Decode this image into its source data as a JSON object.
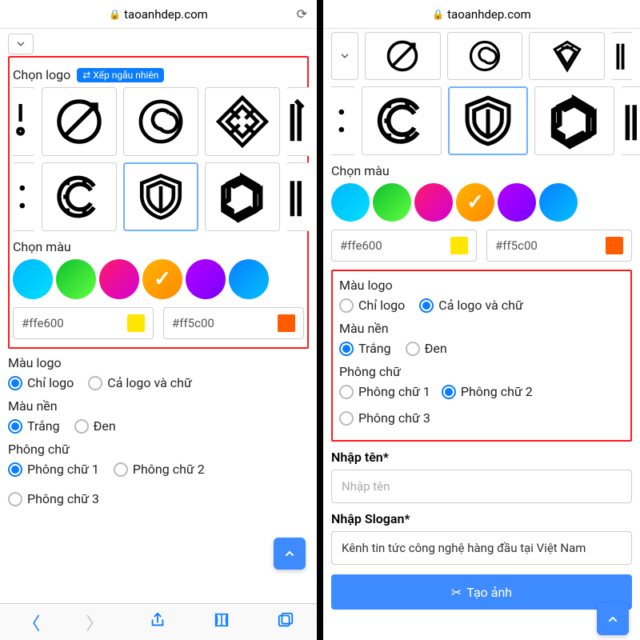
{
  "url_host": "taoanhdep.com",
  "left": {
    "section_logo_title": "Chọn logo",
    "shuffle_label": "Xếp ngẫu nhiên",
    "section_color_title": "Chọn màu",
    "hex1": "#ffe600",
    "hex2": "#ff5c00",
    "mau_logo_title": "Màu logo",
    "mau_logo_opts": [
      "Chỉ logo",
      "Cả logo và chữ"
    ],
    "mau_logo_selected": 0,
    "mau_nen_title": "Màu nền",
    "mau_nen_opts": [
      "Trắng",
      "Đen"
    ],
    "mau_nen_selected": 0,
    "phong_title": "Phông chữ",
    "phong_opts": [
      "Phông chữ 1",
      "Phông chữ 2",
      "Phông chữ 3"
    ],
    "phong_selected": 0
  },
  "right": {
    "section_color_title": "Chọn màu",
    "hex1": "#ffe600",
    "hex2": "#ff5c00",
    "mau_logo_title": "Màu logo",
    "mau_logo_opts": [
      "Chỉ logo",
      "Cả logo và chữ"
    ],
    "mau_logo_selected": 1,
    "mau_nen_title": "Màu nền",
    "mau_nen_opts": [
      "Trắng",
      "Đen"
    ],
    "mau_nen_selected": 0,
    "phong_title": "Phông chữ",
    "phong_opts": [
      "Phông chữ 1",
      "Phông chữ 2",
      "Phông chữ 3"
    ],
    "phong_selected": 1,
    "name_label": "Nhập tên*",
    "name_placeholder": "Nhập tên",
    "slogan_label": "Nhập Slogan*",
    "slogan_value": "Kênh tin tức công nghệ hàng đầu tại Việt Nam",
    "create_label": "Tạo ảnh"
  }
}
